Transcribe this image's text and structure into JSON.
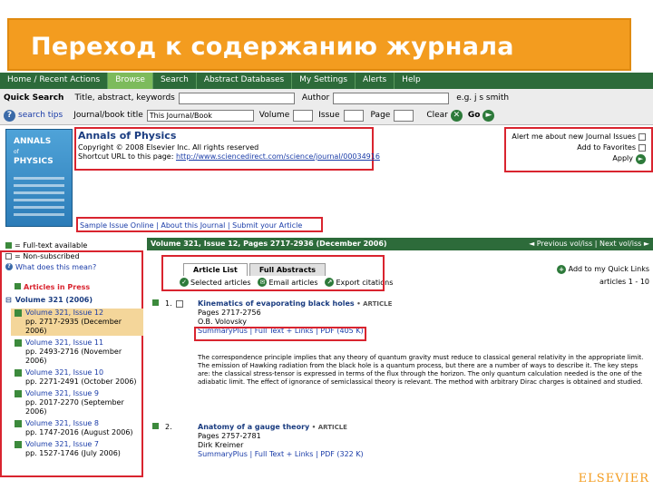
{
  "banner": {
    "title": "Переход к содержанию журнала"
  },
  "nav": {
    "tabs": [
      "Home / Recent Actions",
      "Browse",
      "Search",
      "Abstract Databases",
      "My Settings",
      "Alerts",
      "Help"
    ],
    "active_index": 1
  },
  "quick_search": {
    "label": "Quick Search",
    "title_label": "Title, abstract, keywords",
    "author_label": "Author",
    "examples_label": "e.g. j s smith",
    "search_tips": "search tips",
    "journal_label": "Journal/book title",
    "journal_value": "This Journal/Book",
    "volume_label": "Volume",
    "issue_label": "Issue",
    "page_label": "Page",
    "clear_label": "Clear",
    "go_label": "Go"
  },
  "journal": {
    "cover_title_1": "ANNALS",
    "cover_of": "of",
    "cover_title_2": "PHYSICS",
    "title": "Annals of Physics",
    "copyright": "Copyright © 2008 Elsevier Inc. All rights reserved",
    "shortcut_label": "Shortcut URL to this page:",
    "shortcut_url": "http://www.sciencedirect.com/science/journal/00034916",
    "alert_label": "Alert me about new Journal Issues",
    "favorites_label": "Add to Favorites",
    "apply_label": "Apply",
    "links": "Sample Issue Online  |  About this Journal  |  Submit your Article"
  },
  "sidebar": {
    "legend": [
      "= Full-text available",
      "= Non-subscribed",
      "What does this mean?"
    ],
    "articles_in_press": "Articles in Press",
    "volume_header": "Volume 321 (2006)",
    "issues": [
      {
        "name": "Volume 321, Issue 12",
        "pages": "pp. 2717-2935 (December 2006)"
      },
      {
        "name": "Volume 321, Issue 11",
        "pages": "pp. 2493-2716 (November 2006)"
      },
      {
        "name": "Volume 321, Issue 10",
        "pages": "pp. 2271-2491 (October 2006)"
      },
      {
        "name": "Volume 321, Issue 9",
        "pages": "pp. 2017-2270 (September 2006)"
      },
      {
        "name": "Volume 321, Issue 8",
        "pages": "pp. 1747-2016 (August 2006)"
      },
      {
        "name": "Volume 321, Issue 7",
        "pages": "pp. 1527-1746 (July 2006)"
      }
    ]
  },
  "main": {
    "volume_header": "Volume 321, Issue 12, Pages 2717-2936 (December 2006)",
    "prev_next": "◄ Previous vol/iss  |  Next vol/iss ►",
    "tab_list": "Article List",
    "tab_abstracts": "Full Abstracts",
    "selected_articles": "Selected articles",
    "email_articles": "Email articles",
    "export_citations": "Export citations",
    "alert_link": "Add to my Quick Links",
    "articles_count": "articles 1 - 10",
    "articles": [
      {
        "num": "1.",
        "title": "Kinematics of evaporating black holes",
        "type": "• ARTICLE",
        "pages": "Pages 2717-2756",
        "author": "O.B. Volovsky",
        "links": "SummaryPlus | Full Text + Links | PDF (405 K)"
      },
      {
        "num": "2.",
        "title": "Anatomy of a gauge theory",
        "type": "• ARTICLE",
        "pages": "Pages 2757-2781",
        "author": "Dirk Kreimer",
        "links": "SummaryPlus | Full Text + Links | PDF (322 K)"
      }
    ],
    "abstract": "The correspondence principle implies that any theory of quantum gravity must reduce to classical general relativity in the appropriate limit. The emission of Hawking radiation from the black hole is a quantum process, but there are a number of ways to describe it. The key steps are: the classical stress-tensor is expressed in terms of the flux through the horizon. The only quantum calculation needed is the one of the adiabatic limit. The effect of ignorance of semiclassical theory is relevant. The method with arbitrary Dirac charges is obtained and studied."
  },
  "footer": {
    "brand": "ELSEVIER"
  },
  "colors": {
    "banner": "#f39c1f",
    "nav": "#2d6b3a",
    "nav_active": "#7dbb5c",
    "highlight": "#d9242f"
  }
}
